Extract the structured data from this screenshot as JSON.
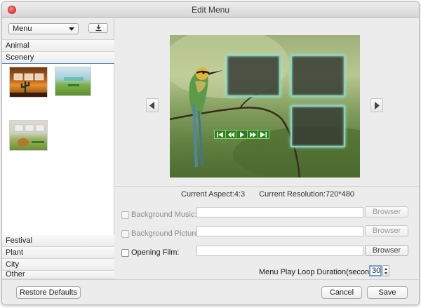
{
  "window": {
    "title": "Edit Menu"
  },
  "sidebar": {
    "menu_select": "Menu",
    "categories_top": [
      "Animal",
      "Scenery"
    ],
    "categories_bottom": [
      "Festival",
      "Plant",
      "City",
      "Other"
    ]
  },
  "preview": {
    "info_aspect": "Current Aspect:4:3",
    "info_resolution": "Current Resolution:720*480"
  },
  "settings": {
    "background_music_label": "Background Music:",
    "background_picture_label": "Background Picture:",
    "opening_film_label": "Opening Film:",
    "browser_label": "Browser",
    "loop_label": "Menu Play Loop Duration(seconds):",
    "loop_value": "30"
  },
  "footer": {
    "restore_label": "Restore Defaults",
    "cancel_label": "Cancel",
    "save_label": "Save"
  },
  "colors": {
    "frame_glow": "#86d1bf",
    "control_bar": "#2e7d1f",
    "focus_ring": "#6aa0d9"
  }
}
